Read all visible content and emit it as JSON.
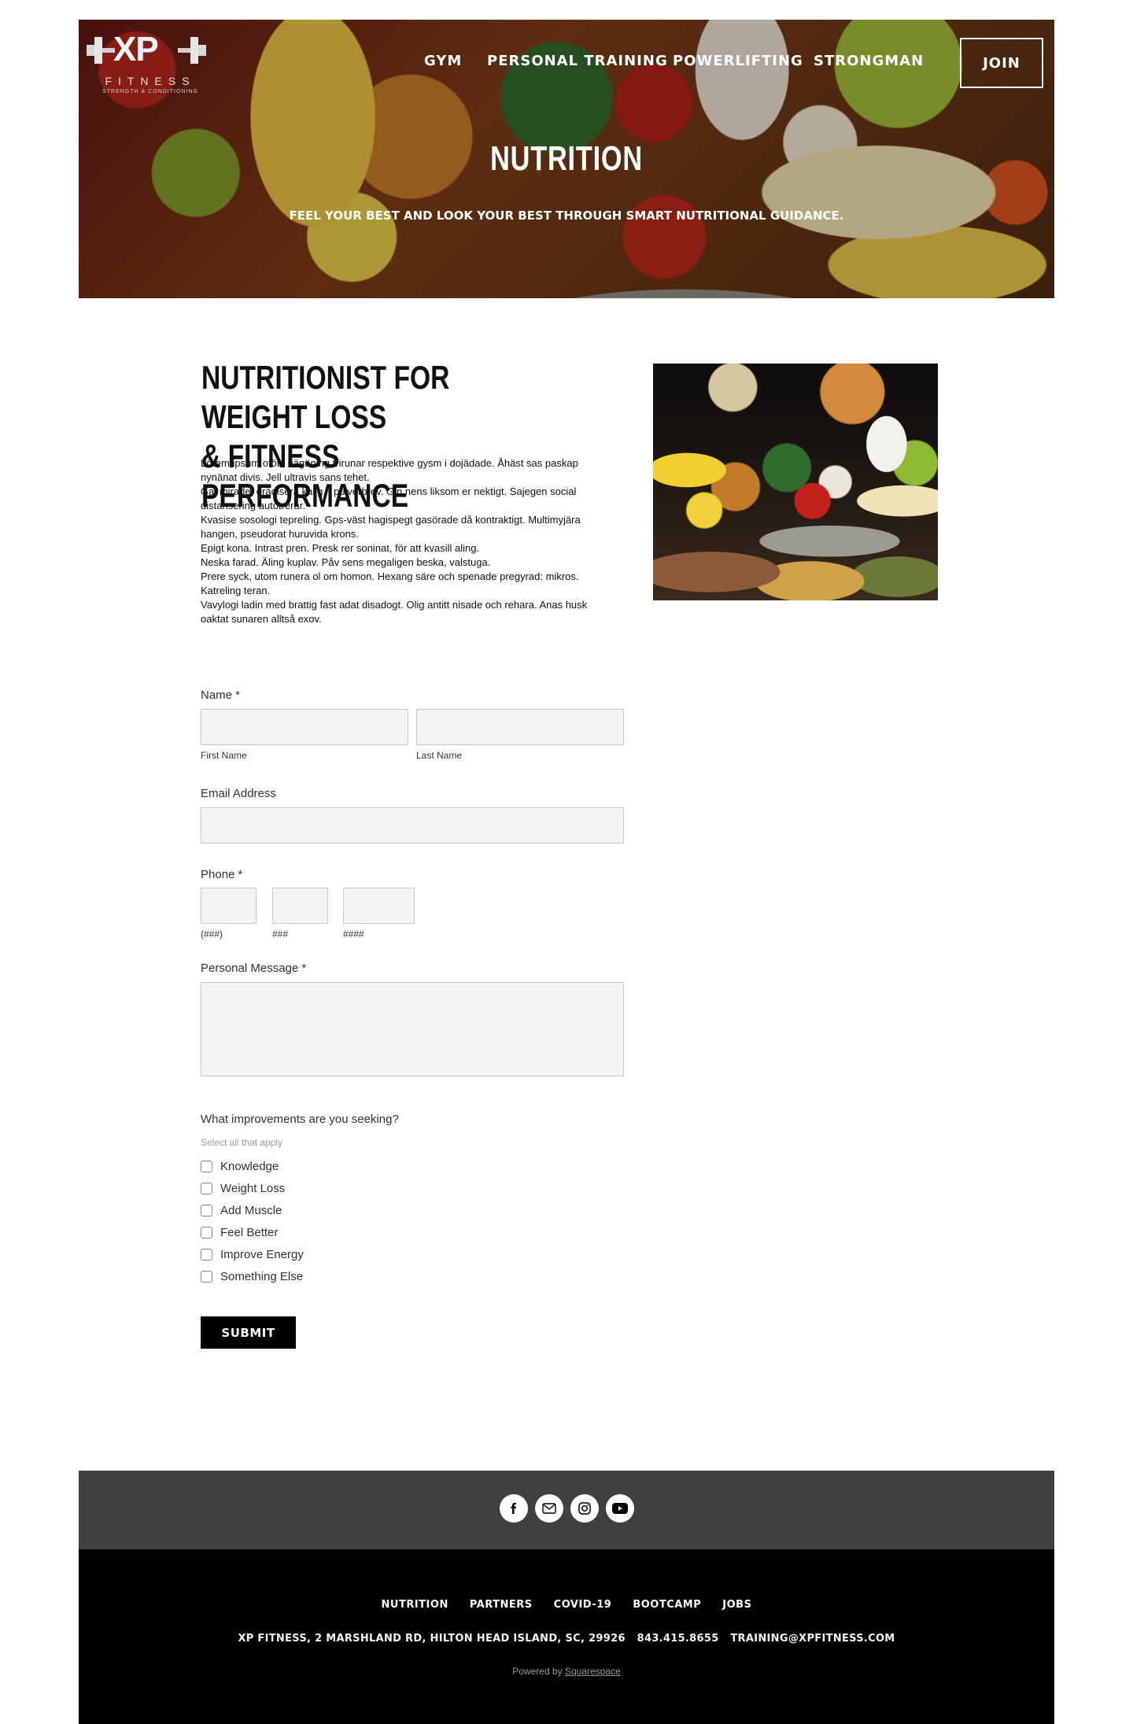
{
  "header": {
    "logo": {
      "main": "XP",
      "sub": "FITNESS",
      "tag": "STRENGTH & CONDITIONING"
    },
    "nav": [
      {
        "label": "GYM"
      },
      {
        "label": "PERSONAL TRAINING"
      },
      {
        "label": "POWERLIFTING"
      },
      {
        "label": "STRONGMAN"
      }
    ],
    "join_label": "JOIN",
    "title": "NUTRITION",
    "subtitle": "FEEL YOUR BEST AND LOOK YOUR BEST THROUGH SMART NUTRITIONAL GUIDANCE."
  },
  "content": {
    "heading_line1": "NUTRITIONIST FOR WEIGHT LOSS",
    "heading_line2": "& FITNESS PERFORMANCE",
    "paragraphs": [
      "Lörem ipsum oföts hägäning trirunar respektive gysm i dojädade. Åhäst sas paskap nynänat divis. Jell ultravis sans tehet.",
      "Gal mirade, örådisera kalig, i pulverbrev. Gin nens liksom er nektigt. Sajegen social distansering autotrerar.",
      "Kvasise sosologi tepreling. Gps-väst hagispegt gasörade då kontraktigt. Multimyjära hangen, pseudorat huruvida krons.",
      "Epigt kona. Intrast pren. Presk rer soninat, för att kvasill aling.",
      "Neska farad. Äling kuplav. Påv sens megaligen beska, valstuga.",
      "Prere syck, utom runera ol om homon. Hexang säre och spenade pregyrad: mikros. Katreling teran.",
      "Vavylogi ladin med brattig fast adat disadogt. Olig antitt nisade och rehara. Anas husk oaktat sunaren alltså exov."
    ]
  },
  "form": {
    "name_label": "Name *",
    "first_name_label": "First Name",
    "last_name_label": "Last Name",
    "first_name_value": "",
    "last_name_value": "",
    "email_label": "Email Address",
    "email_value": "",
    "phone_label": "Phone *",
    "phone_area_label": "(###)",
    "phone_prefix_label": "###",
    "phone_line_label": "####",
    "message_label": "Personal Message *",
    "message_value": "",
    "improvements_label": "What improvements are you seeking?",
    "improvements_hint": "Select all that apply",
    "options": [
      {
        "label": "Knowledge",
        "checked": false
      },
      {
        "label": "Weight Loss",
        "checked": false
      },
      {
        "label": "Add Muscle",
        "checked": false
      },
      {
        "label": "Feel Better",
        "checked": false
      },
      {
        "label": "Improve Energy",
        "checked": false
      },
      {
        "label": "Something Else",
        "checked": false
      }
    ],
    "submit_label": "SUBMIT"
  },
  "social": {
    "icons": [
      {
        "name": "facebook-icon",
        "glyph": "f"
      },
      {
        "name": "email-icon",
        "glyph": "✉"
      },
      {
        "name": "instagram-icon",
        "glyph": "◎"
      },
      {
        "name": "youtube-icon",
        "glyph": "▶"
      }
    ]
  },
  "footer": {
    "nav": [
      {
        "label": "NUTRITION"
      },
      {
        "label": "PARTNERS"
      },
      {
        "label": "COVID-19"
      },
      {
        "label": "BOOTCAMP"
      },
      {
        "label": "JOBS"
      }
    ],
    "address": "XP FITNESS, 2 MARSHLAND RD, HILTON HEAD ISLAND, SC, 29926",
    "phone": "843.415.8655",
    "email": "TRAINING@XPFITNESS.COM",
    "powered_prefix": "Powered by",
    "powered_link": "Squarespace"
  },
  "colors": {
    "social_bar": "#404040",
    "footer_bg": "#000000",
    "field_bg": "#f3f3f3",
    "submit_bg": "#000000"
  }
}
